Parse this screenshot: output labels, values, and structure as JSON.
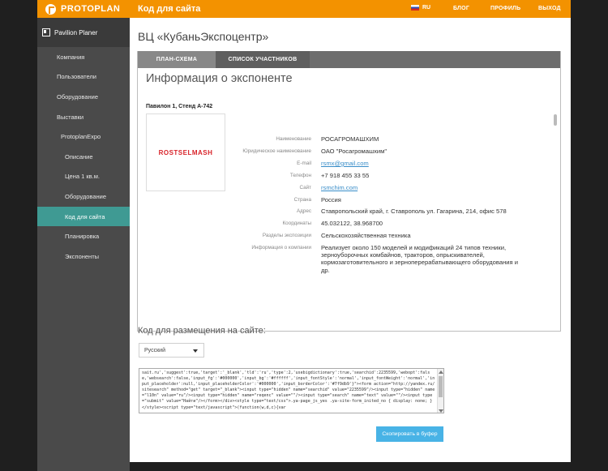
{
  "header": {
    "logo": "PROTOPLAN",
    "title": "Код для сайта",
    "lang": "RU",
    "links": [
      "БЛОГ",
      "ПРОФИЛЬ",
      "ВЫХОД"
    ]
  },
  "sidebar": {
    "brand": "Pavilion Planer",
    "items": [
      {
        "label": "Компания",
        "indent": 1
      },
      {
        "label": "Пользователи",
        "indent": 1
      },
      {
        "label": "Оборудование",
        "indent": 1
      },
      {
        "label": "Выставки",
        "indent": 1
      },
      {
        "label": "ProtoplanExpo",
        "indent": 2
      },
      {
        "label": "Описание",
        "indent": 3
      },
      {
        "label": "Цена 1 кв.м.",
        "indent": 3
      },
      {
        "label": "Оборудование",
        "indent": 3
      },
      {
        "label": "Код для сайта",
        "indent": 3,
        "active": true
      },
      {
        "label": "Планировка",
        "indent": 3
      },
      {
        "label": "Экспоненты",
        "indent": 3
      }
    ]
  },
  "main": {
    "page_title": "ВЦ «КубаньЭкспоцентр»",
    "tabs": [
      "ПЛАН-СХЕМА",
      "СПИСОК УЧАСТНИКОВ"
    ],
    "info_title": "Информация о экспоненте",
    "stand": "Павилон 1, Стенд А-742",
    "exhibitor_logo": "ROSTSELMASH",
    "fields": [
      {
        "label": "Наименование",
        "value": "РОСАГРОМАШХИМ"
      },
      {
        "label": "Юридическое наименование",
        "value": "ОАО \"Росагромашхим\""
      },
      {
        "label": "E-mail",
        "value": "rsmx@gmail.com",
        "link": true
      },
      {
        "label": "Телефон",
        "value": "+7 918 455 33 55"
      },
      {
        "label": "Сайт",
        "value": "rsmchim.com",
        "link": true
      },
      {
        "label": "Страна",
        "value": "Россия"
      },
      {
        "label": "Адрес",
        "value": "Ставропольский край, г. Ставрополь ул. Гагарина, 214, офис 578"
      },
      {
        "label": "Координаты",
        "value": "45.032122, 38.968700"
      },
      {
        "label": "Разделы экспозиции",
        "value": "Сельскохозяйственная техника"
      },
      {
        "label": "Информация о компании",
        "value": "Реализует около 150 моделей и модификаций 24 типов техники, зерноуборочных комбайнов, тракторов, опрыскивателей, кормозаготовительного и зерноперерабатывающего оборудования и др.",
        "multi": true
      }
    ],
    "code_title": "Код для размещения на сайте:",
    "language_select": "Русский",
    "code_text": "sait.ru','suggest':true,'target':'_blank','tld':'ru','type':2,'usebigdictionary':true,'searchid':2235599,'webopt':false,'websearch':false,'input_fg':'#000000','input_bg':'#ffffff','input_fontStyle':'normal','input_fontWeight':'normal','input_placeholder':null,'input_placeholderColor':'#000000','input_borderColor':'#7f9db9'}\"><form action=\"http://yandex.ru/sitesearch\" method=\"get\" target=\"_blank\"><input type=\"hidden\" name=\"searchid\" value=\"2235599\"/><input type=\"hidden\" name=\"l10n\" value=\"ru\"/><input type=\"hidden\" name=\"reqenc\" value=\"\"/><input type=\"search\" name=\"text\" value=\"\"/><input type=\"submit\" value=\"Найти\"/></form></div><style type=\"text/css\">.ya-page_js_yes .ya-site-form_inited_no { display: none; }</style><script type=\"text/javascript\">(function(w,d,c){var",
    "copy_button": "Скопировать в буфер"
  }
}
